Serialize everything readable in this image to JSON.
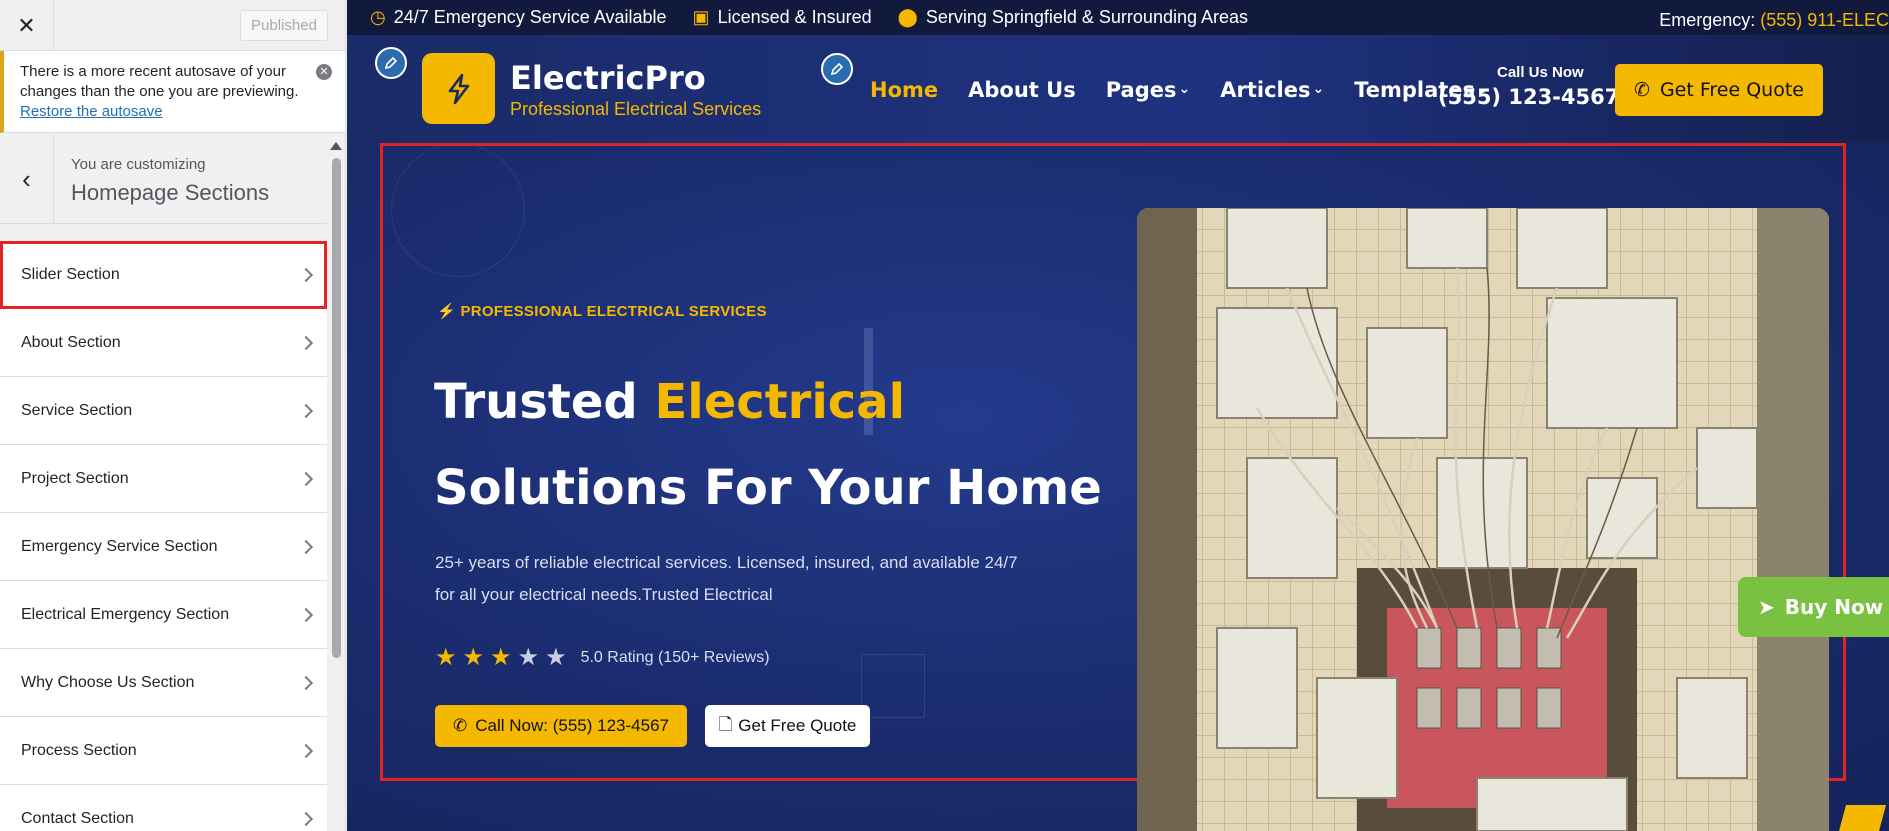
{
  "sidebar": {
    "close_icon": "close-icon",
    "published_label": "Published",
    "notice": {
      "text": "There is a more recent autosave of your changes than the one you are previewing.",
      "link": "Restore the autosave"
    },
    "customizing_label": "You are customizing",
    "section_title": "Homepage Sections",
    "items": [
      {
        "label": "Slider Section"
      },
      {
        "label": "About Section"
      },
      {
        "label": "Service Section"
      },
      {
        "label": "Project Section"
      },
      {
        "label": "Emergency Service Section"
      },
      {
        "label": "Electrical Emergency Section"
      },
      {
        "label": "Why Choose Us Section"
      },
      {
        "label": "Process Section"
      },
      {
        "label": "Contact Section"
      }
    ]
  },
  "topbar": {
    "item1": "24/7 Emergency Service Available",
    "item2": "Licensed & Insured",
    "item3": "Serving Springfield & Surrounding Areas",
    "emergency_label": "Emergency: ",
    "emergency_phone": "(555) 911-ELEC"
  },
  "header": {
    "brand": "ElectricPro",
    "tagline": "Professional Electrical Services",
    "nav": [
      "Home",
      "About Us",
      "Pages",
      "Articles",
      "Templates"
    ],
    "call_label": "Call Us Now",
    "call_phone": "(555) 123-4567",
    "quote_button": "Get Free Quote"
  },
  "hero": {
    "eyebrow": "PROFESSIONAL ELECTRICAL SERVICES",
    "title_part1": "Trusted ",
    "title_highlight": "Electrical",
    "title_line2": "Solutions For Your Home",
    "description": "25+ years of reliable electrical services. Licensed, insured, and available 24/7 for all your electrical needs.Trusted Electrical",
    "rating_value": 3,
    "rating_max": 5,
    "rating_text": "5.0 Rating (150+ Reviews)",
    "call_button": "Call Now: (555) 123-4567",
    "quote_button": "Get Free Quote",
    "buy_now": "Buy Now"
  },
  "colors": {
    "accent": "#f5b800",
    "navy": "#1a2a6c",
    "highlight_border": "#e02424",
    "buy_green": "#7ac142"
  }
}
